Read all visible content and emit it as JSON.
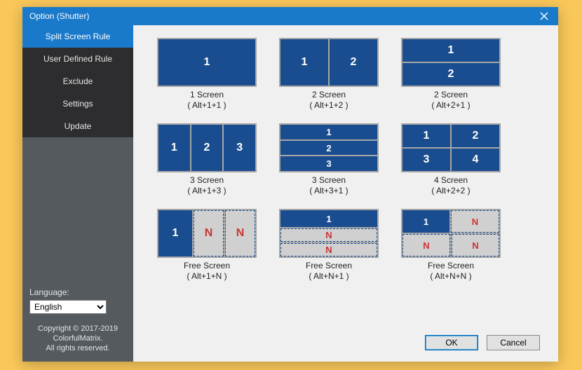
{
  "window": {
    "title": "Option (Shutter)"
  },
  "sidebar": {
    "items": [
      {
        "label": "Split Screen Rule"
      },
      {
        "label": "User Defined Rule"
      },
      {
        "label": "Exclude"
      },
      {
        "label": "Settings"
      },
      {
        "label": "Update"
      }
    ],
    "language_label": "Language:",
    "language_value": "English",
    "copyright_line1": "Copyright © 2017-2019",
    "copyright_line2": "ColorfulMatrix.",
    "copyright_line3": "All rights reserved."
  },
  "tiles": [
    {
      "title": "1 Screen",
      "shortcut": "( Alt+1+1 )"
    },
    {
      "title": "2 Screen",
      "shortcut": "( Alt+1+2 )"
    },
    {
      "title": "2 Screen",
      "shortcut": "( Alt+2+1 )"
    },
    {
      "title": "3 Screen",
      "shortcut": "( Alt+1+3 )"
    },
    {
      "title": "3 Screen",
      "shortcut": "( Alt+3+1 )"
    },
    {
      "title": "4 Screen",
      "shortcut": "( Alt+2+2 )"
    },
    {
      "title": "Free Screen",
      "shortcut": "( Alt+1+N )"
    },
    {
      "title": "Free Screen",
      "shortcut": "( Alt+N+1 )"
    },
    {
      "title": "Free Screen",
      "shortcut": "( Alt+N+N )"
    }
  ],
  "cells": {
    "n1": "1",
    "n2": "2",
    "n3": "3",
    "n4": "4",
    "nn": "N"
  },
  "buttons": {
    "ok": "OK",
    "cancel": "Cancel"
  }
}
